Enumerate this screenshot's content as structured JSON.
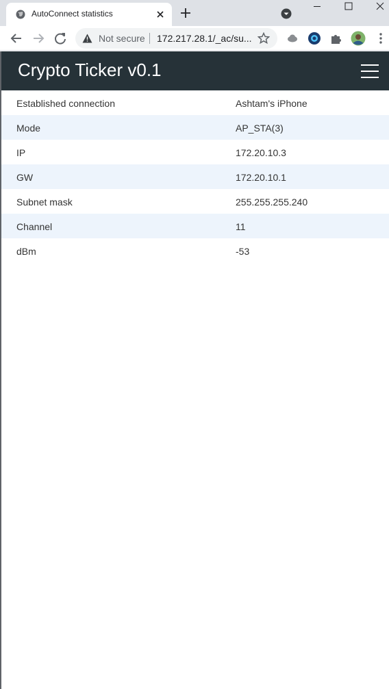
{
  "browser": {
    "tab_title": "AutoConnect statistics",
    "security_label": "Not secure",
    "url": "172.217.28.1/_ac/su..."
  },
  "header": {
    "title": "Crypto Ticker v0.1"
  },
  "stats": {
    "rows": [
      {
        "label": "Established connection",
        "value": "Ashtam's iPhone"
      },
      {
        "label": "Mode",
        "value": "AP_STA(3)"
      },
      {
        "label": "IP",
        "value": "172.20.10.3"
      },
      {
        "label": "GW",
        "value": "172.20.10.1"
      },
      {
        "label": "Subnet mask",
        "value": "255.255.255.240"
      },
      {
        "label": "Channel",
        "value": "11"
      },
      {
        "label": "dBm",
        "value": "-53"
      }
    ]
  },
  "colors": {
    "header_bg": "#263238",
    "row_alt_bg": "#edf4fc"
  }
}
